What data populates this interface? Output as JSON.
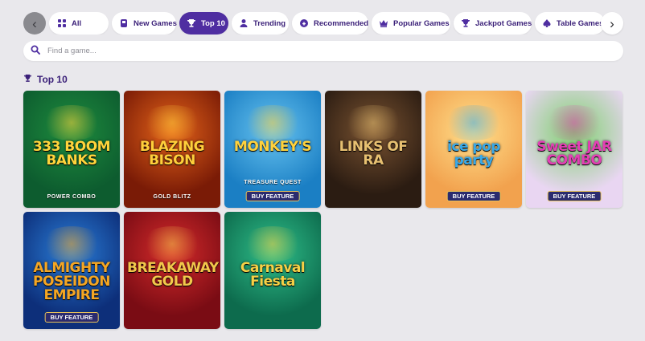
{
  "nav": {
    "prev_icon": "chevron-left-icon",
    "next_icon": "chevron-right-icon",
    "tabs": [
      {
        "label": "All",
        "icon": "grid-icon",
        "active": false
      },
      {
        "label": "New Games",
        "icon": "new-games-icon",
        "active": false
      },
      {
        "label": "Top 10",
        "icon": "trophy-icon",
        "active": true
      },
      {
        "label": "Trending",
        "icon": "person-icon",
        "active": false
      },
      {
        "label": "Recommended",
        "icon": "thumb-icon",
        "active": false
      },
      {
        "label": "Popular Games",
        "icon": "crown-icon",
        "active": false
      },
      {
        "label": "Jackpot Games",
        "icon": "trophy-icon",
        "active": false
      },
      {
        "label": "Table Games",
        "icon": "spade-icon",
        "active": false
      },
      {
        "label": "",
        "icon": "spiral-icon",
        "active": false
      }
    ]
  },
  "search": {
    "placeholder": "Find a game...",
    "value": ""
  },
  "section": {
    "title": "Top 10",
    "icon": "trophy-icon"
  },
  "games": [
    {
      "title": "333 BOOM BANKS",
      "subtitle": "POWER COMBO",
      "badge": "",
      "colors": [
        "#0d5c2f",
        "#1e8c3e",
        "#ffd43b"
      ]
    },
    {
      "title": "BLAZING BISON",
      "subtitle": "GOLD BLITZ",
      "badge": "",
      "colors": [
        "#7a1b06",
        "#e5641a",
        "#ffcf3b"
      ]
    },
    {
      "title": "MONKEY'S",
      "subtitle": "TREASURE QUEST",
      "badge": "BUY FEATURE",
      "colors": [
        "#1b7fc4",
        "#67c3f0",
        "#ffd23d"
      ]
    },
    {
      "title": "LINKS OF RA",
      "subtitle": "",
      "badge": "",
      "colors": [
        "#2b1c12",
        "#7a5331",
        "#e7c071"
      ]
    },
    {
      "title": "ice pop party",
      "subtitle": "",
      "badge": "BUY FEATURE",
      "colors": [
        "#f2a24e",
        "#ffe08c",
        "#39a9e8"
      ]
    },
    {
      "title": "Sweet JAR COMBO",
      "subtitle": "",
      "badge": "BUY FEATURE",
      "colors": [
        "#e9d6f2",
        "#7ed06d",
        "#e43fb5"
      ]
    },
    {
      "title": "ALMIGHTY POSEIDON EMPIRE",
      "subtitle": "",
      "badge": "BUY FEATURE",
      "colors": [
        "#0d2f7a",
        "#2b7fd9",
        "#f5a623"
      ]
    },
    {
      "title": "BREAKAWAY GOLD",
      "subtitle": "",
      "badge": "",
      "colors": [
        "#7a0c14",
        "#d62b2b",
        "#f2c84b"
      ]
    },
    {
      "title": "Carnaval Fiesta",
      "subtitle": "",
      "badge": "",
      "colors": [
        "#0d6b4d",
        "#2fbf8a",
        "#f7d046"
      ]
    }
  ]
}
